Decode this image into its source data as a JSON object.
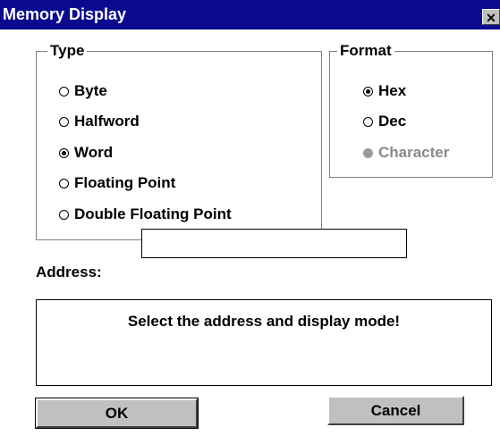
{
  "window": {
    "title": "Memory Display",
    "close_glyph": "✕"
  },
  "type_group": {
    "label": "Type",
    "options": [
      {
        "label": "Byte",
        "checked": false
      },
      {
        "label": "Halfword",
        "checked": false
      },
      {
        "label": "Word",
        "checked": true
      },
      {
        "label": "Floating Point",
        "checked": false
      },
      {
        "label": "Double Floating Point",
        "checked": false
      }
    ]
  },
  "format_group": {
    "label": "Format",
    "options": [
      {
        "label": "Hex",
        "checked": true,
        "disabled": false
      },
      {
        "label": "Dec",
        "checked": false,
        "disabled": false
      },
      {
        "label": "Character",
        "checked": false,
        "disabled": true
      }
    ]
  },
  "address": {
    "label": "Address:",
    "value": ""
  },
  "message": "Select the address and display mode!",
  "buttons": {
    "ok": "OK",
    "cancel": "Cancel"
  }
}
